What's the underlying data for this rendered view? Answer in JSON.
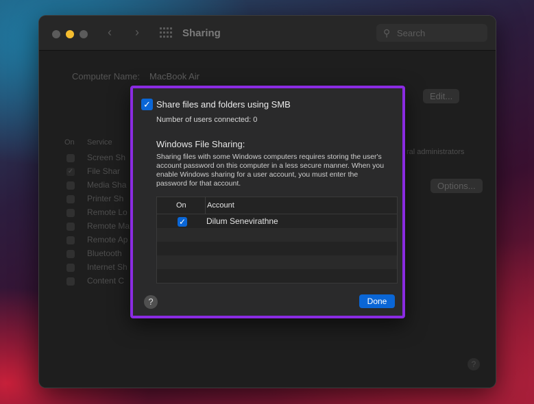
{
  "window": {
    "title": "Sharing"
  },
  "search": {
    "placeholder": "Search"
  },
  "background": {
    "computer_name_label": "Computer Name:",
    "computer_name_value": "MacBook Air",
    "edit_button": "Edit...",
    "col_on": "On",
    "col_service": "Service",
    "services": [
      "Screen Sh",
      "File Shar",
      "Media Sha",
      "Printer Sh",
      "Remote Lo",
      "Remote Ma",
      "Remote Ap",
      "Bluetooth",
      "Internet Sh",
      "Content C"
    ],
    "admins_text": "ral administrators",
    "options_button": "Options..."
  },
  "dialog": {
    "share_label": "Share files and folders using SMB",
    "users_connected": "Number of users connected: 0",
    "wfs_heading": "Windows File Sharing:",
    "wfs_description": "Sharing files with some Windows computers requires storing the user's account password on this computer in a less secure manner. When you enable Windows sharing for a user account, you must enter the password for that account.",
    "table": {
      "col_on": "On",
      "col_account": "Account",
      "rows": [
        {
          "on": true,
          "account": "Dilum Senevirathne"
        }
      ]
    },
    "help_label": "?",
    "done_label": "Done"
  },
  "colors": {
    "accent": "#0a66d6",
    "highlight_border": "#8a2be2"
  }
}
